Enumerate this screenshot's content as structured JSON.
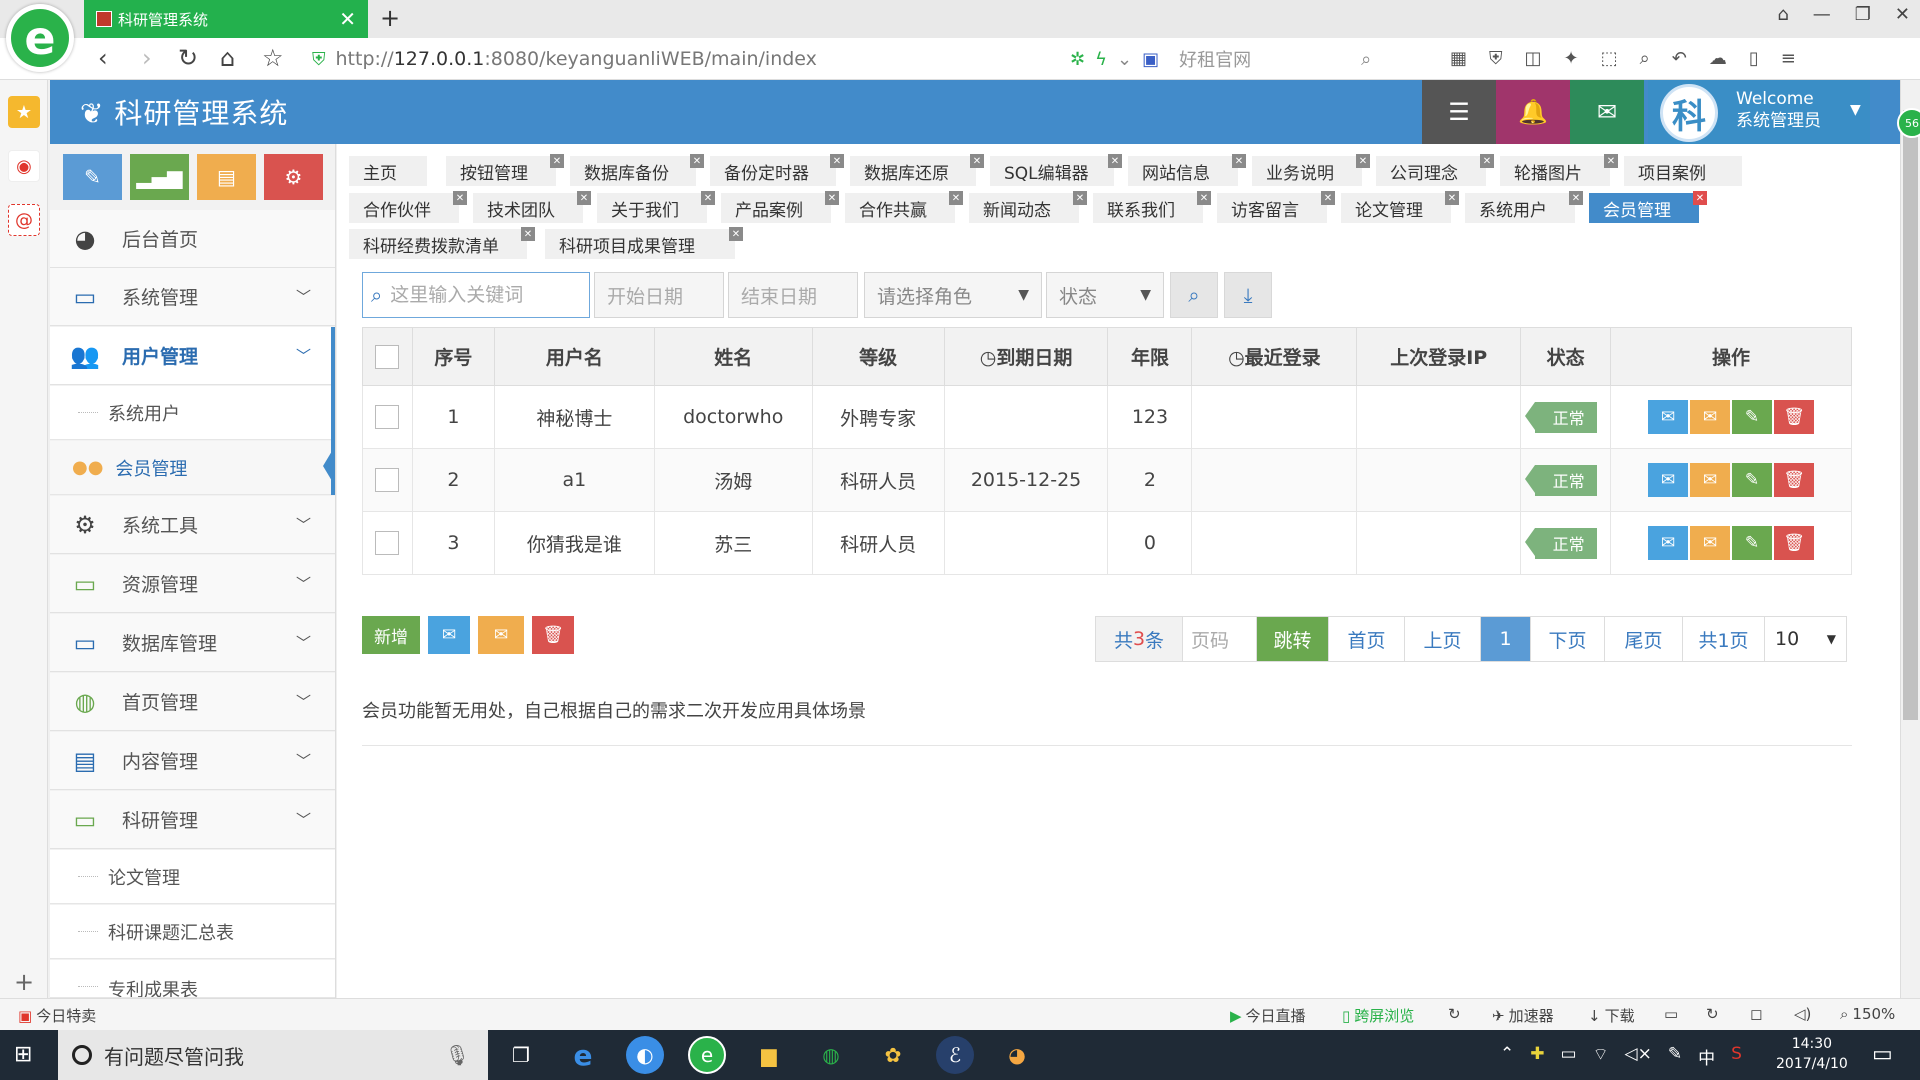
{
  "browser": {
    "tab_title": "科研管理系统",
    "url_prefix": "http://",
    "url_host": "127.0.0.1",
    "url_rest": ":8080/keyanguanliWEB/main/index",
    "search_engine_text": "好租官网",
    "zoom": "150%"
  },
  "app": {
    "title": "科研管理系统",
    "welcome": "Welcome",
    "username": "系统管理员",
    "avatar_char": "科",
    "badge_count": "56"
  },
  "sidebar": {
    "items": [
      {
        "label": "后台首页"
      },
      {
        "label": "系统管理"
      },
      {
        "label": "用户管理"
      },
      {
        "label": "系统用户"
      },
      {
        "label": "会员管理"
      },
      {
        "label": "系统工具"
      },
      {
        "label": "资源管理"
      },
      {
        "label": "数据库管理"
      },
      {
        "label": "首页管理"
      },
      {
        "label": "内容管理"
      },
      {
        "label": "科研管理"
      },
      {
        "label": "论文管理"
      },
      {
        "label": "科研课题汇总表"
      },
      {
        "label": "专利成果表"
      }
    ]
  },
  "tabs": [
    {
      "label": "主页"
    },
    {
      "label": "按钮管理"
    },
    {
      "label": "数据库备份"
    },
    {
      "label": "备份定时器"
    },
    {
      "label": "数据库还原"
    },
    {
      "label": "SQL编辑器"
    },
    {
      "label": "网站信息"
    },
    {
      "label": "业务说明"
    },
    {
      "label": "公司理念"
    },
    {
      "label": "轮播图片"
    },
    {
      "label": "项目案例"
    },
    {
      "label": "合作伙伴"
    },
    {
      "label": "技术团队"
    },
    {
      "label": "关于我们"
    },
    {
      "label": "产品案例"
    },
    {
      "label": "合作共赢"
    },
    {
      "label": "新闻动态"
    },
    {
      "label": "联系我们"
    },
    {
      "label": "访客留言"
    },
    {
      "label": "论文管理"
    },
    {
      "label": "系统用户"
    },
    {
      "label": "会员管理"
    },
    {
      "label": "科研经费拨款清单"
    },
    {
      "label": "科研项目成果管理"
    }
  ],
  "filters": {
    "keyword_placeholder": "这里输入关键词",
    "start_date": "开始日期",
    "end_date": "结束日期",
    "role": "请选择角色",
    "status": "状态"
  },
  "table": {
    "headers": {
      "seq": "序号",
      "username": "用户名",
      "name": "姓名",
      "level": "等级",
      "expire": "到期日期",
      "years": "年限",
      "last_login": "最近登录",
      "last_ip": "上次登录IP",
      "status": "状态",
      "ops": "操作"
    },
    "rows": [
      {
        "seq": "1",
        "username": "神秘博士",
        "name": "doctorwho",
        "level": "外聘专家",
        "expire": "",
        "years": "123",
        "last_login": "",
        "last_ip": "",
        "status": "正常"
      },
      {
        "seq": "2",
        "username": "a1",
        "name": "汤姆",
        "level": "科研人员",
        "expire": "2015-12-25",
        "years": "2",
        "last_login": "",
        "last_ip": "",
        "status": "正常"
      },
      {
        "seq": "3",
        "username": "你猜我是谁",
        "name": "苏三",
        "level": "科研人员",
        "expire": "",
        "years": "0",
        "last_login": "",
        "last_ip": "",
        "status": "正常"
      }
    ]
  },
  "actions": {
    "add": "新增"
  },
  "pager": {
    "total_prefix": "共",
    "total_count": "3",
    "total_suffix": "条",
    "page_placeholder": "页码",
    "go": "跳转",
    "first": "首页",
    "prev": "上页",
    "current": "1",
    "next": "下页",
    "last": "尾页",
    "pages": "共1页",
    "size": "10"
  },
  "note": "会员功能暂无用处，自己根据自己的需求二次开发应用具体场景",
  "statusbar": {
    "left": "今日特卖",
    "live": "今日直播",
    "cross": "跨屏浏览",
    "accel": "加速器",
    "download": "下载",
    "zoom": "150%"
  },
  "taskbar": {
    "search_placeholder": "有问题尽管问我",
    "time": "14:30",
    "date": "2017/4/10",
    "ime": "中"
  },
  "colors": {
    "header": "#428bca",
    "active_tab": "#428bca",
    "status_ok": "#7db37d"
  }
}
